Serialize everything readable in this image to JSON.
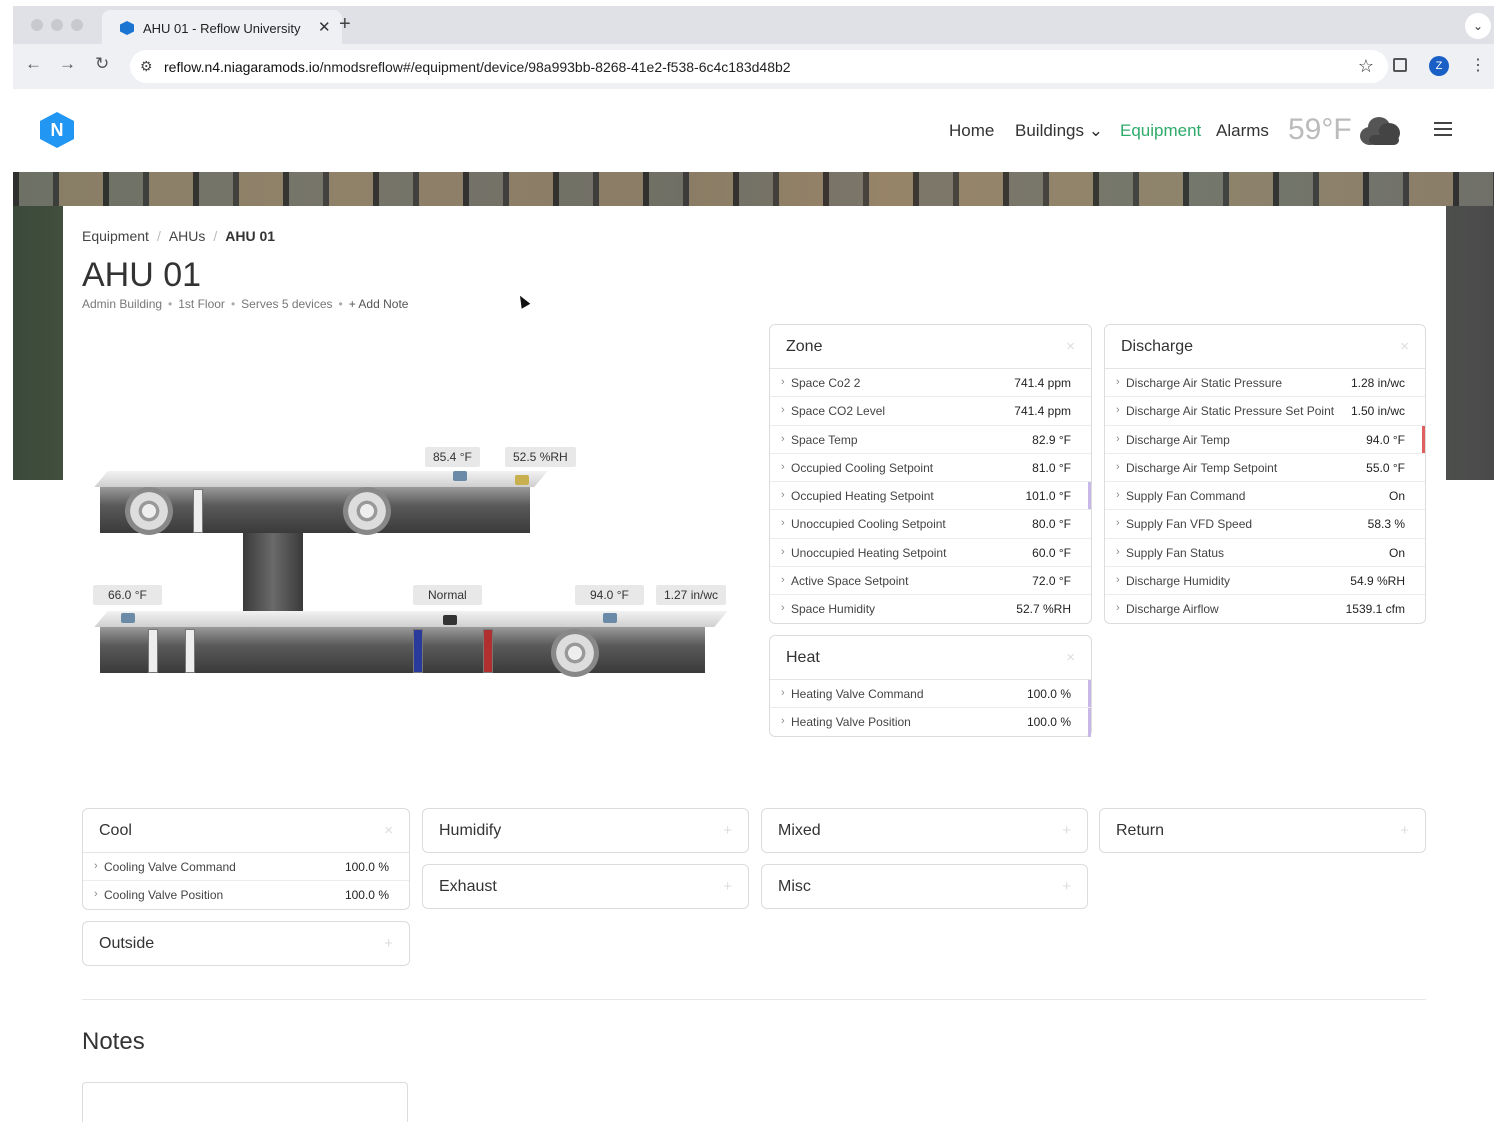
{
  "browser": {
    "tab_title": "AHU 01 - Reflow University",
    "tab_close": "✕",
    "new_tab": "+",
    "url_host": "reflow.n4.niagaramods.io",
    "url_path": "/nmodsreflow#/equipment/device/98a993bb-8268-41e2-f538-6c4c183d48b2",
    "profile_initial": "Z"
  },
  "header": {
    "logo_letter": "N",
    "nav": [
      {
        "label": "Home"
      },
      {
        "label": "Buildings ⌄"
      },
      {
        "label": "Equipment"
      },
      {
        "label": "Alarms"
      }
    ],
    "weather_temp": "59°F"
  },
  "breadcrumb": [
    "Equipment",
    "AHUs",
    "AHU 01"
  ],
  "page": {
    "title": "AHU 01",
    "meta": [
      "Admin Building",
      "1st Floor",
      "Serves 5 devices",
      "+ Add Note"
    ]
  },
  "diagram": {
    "labels": [
      "85.4 °F",
      "52.5 %RH",
      "66.0 °F",
      "Normal",
      "94.0 °F",
      "1.27 in/wc"
    ]
  },
  "panels": {
    "zone": {
      "title": "Zone",
      "rows": [
        {
          "label": "Space Co2 2",
          "value": "741.4 ppm"
        },
        {
          "label": "Space CO2 Level",
          "value": "741.4 ppm"
        },
        {
          "label": "Space Temp",
          "value": "82.9 °F"
        },
        {
          "label": "Occupied Cooling Setpoint",
          "value": "81.0 °F"
        },
        {
          "label": "Occupied Heating Setpoint",
          "value": "101.0 °F"
        },
        {
          "label": "Unoccupied Cooling Setpoint",
          "value": "80.0 °F"
        },
        {
          "label": "Unoccupied Heating Setpoint",
          "value": "60.0 °F"
        },
        {
          "label": "Active Space Setpoint",
          "value": "72.0 °F"
        },
        {
          "label": "Space Humidity",
          "value": "52.7 %RH"
        }
      ]
    },
    "discharge": {
      "title": "Discharge",
      "rows": [
        {
          "label": "Discharge Air Static Pressure",
          "value": "1.28 in/wc"
        },
        {
          "label": "Discharge Air Static Pressure Set Point",
          "value": "1.50 in/wc"
        },
        {
          "label": "Discharge Air Temp",
          "value": "94.0 °F"
        },
        {
          "label": "Discharge Air Temp Setpoint",
          "value": "55.0 °F"
        },
        {
          "label": "Supply Fan Command",
          "value": "On"
        },
        {
          "label": "Supply Fan VFD Speed",
          "value": "58.3 %"
        },
        {
          "label": "Supply Fan Status",
          "value": "On"
        },
        {
          "label": "Discharge Humidity",
          "value": "54.9 %RH"
        },
        {
          "label": "Discharge Airflow",
          "value": "1539.1 cfm"
        }
      ]
    },
    "heat": {
      "title": "Heat",
      "rows": [
        {
          "label": "Heating Valve Command",
          "value": "100.0 %"
        },
        {
          "label": "Heating Valve Position",
          "value": "100.0 %"
        }
      ]
    },
    "cool": {
      "title": "Cool",
      "rows": [
        {
          "label": "Cooling Valve Command",
          "value": "100.0 %"
        },
        {
          "label": "Cooling Valve Position",
          "value": "100.0 %"
        }
      ]
    },
    "humidify": {
      "title": "Humidify"
    },
    "mixed": {
      "title": "Mixed"
    },
    "return": {
      "title": "Return"
    },
    "exhaust": {
      "title": "Exhaust"
    },
    "misc": {
      "title": "Misc"
    },
    "outside": {
      "title": "Outside"
    }
  },
  "icons": {
    "close": "×",
    "expand": "+",
    "chevron": "›"
  },
  "colors": {
    "active_nav": "#2eaa6b",
    "alarm_bar": "#e06060",
    "heat_bar": "#c7b8e8"
  },
  "notes": {
    "title": "Notes"
  }
}
